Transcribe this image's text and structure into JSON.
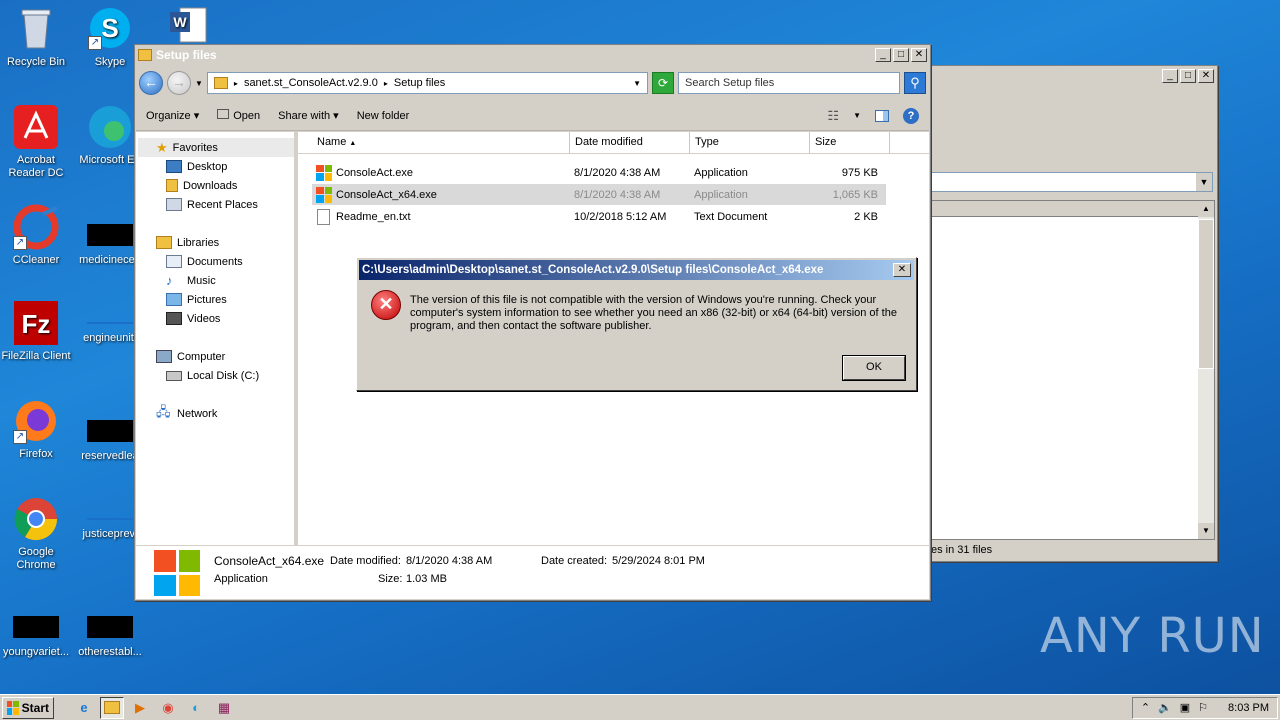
{
  "desktop": {
    "icons": [
      {
        "label": "Recycle Bin"
      },
      {
        "label": "Skype"
      },
      {
        "label": "Acrobat Reader DC"
      },
      {
        "label": "Microsoft Ed"
      },
      {
        "label": "CCleaner"
      },
      {
        "label": "medicinecen"
      },
      {
        "label": "FileZilla Client"
      },
      {
        "label": "engineunit."
      },
      {
        "label": "Firefox"
      },
      {
        "label": "reservedlea"
      },
      {
        "label": "Google Chrome"
      },
      {
        "label": "justiceprevi"
      },
      {
        "label": "youngvariet..."
      },
      {
        "label": "otherestabl..."
      }
    ]
  },
  "back_window": {
    "status_fragment": "es in 31 files"
  },
  "explorer": {
    "title": "Setup files",
    "breadcrumb": [
      "sanet.st_ConsoleAct.v2.9.0",
      "Setup files"
    ],
    "search_placeholder": "Search Setup files",
    "toolbar": {
      "organize": "Organize",
      "open": "Open",
      "share_with": "Share with",
      "new_folder": "New folder"
    },
    "nav": {
      "favorites": "Favorites",
      "favorites_items": [
        "Desktop",
        "Downloads",
        "Recent Places"
      ],
      "libraries": "Libraries",
      "libraries_items": [
        "Documents",
        "Music",
        "Pictures",
        "Videos"
      ],
      "computer": "Computer",
      "computer_items": [
        "Local Disk (C:)"
      ],
      "network": "Network"
    },
    "columns": {
      "name": "Name",
      "date": "Date modified",
      "type": "Type",
      "size": "Size"
    },
    "files": [
      {
        "name": "ConsoleAct.exe",
        "date": "8/1/2020 4:38 AM",
        "type": "Application",
        "size": "975 KB",
        "icon": "ms-logo-icon"
      },
      {
        "name": "ConsoleAct_x64.exe",
        "date": "8/1/2020 4:38 AM",
        "type": "Application",
        "size": "1,065 KB",
        "icon": "ms-logo-icon",
        "selected": true
      },
      {
        "name": "Readme_en.txt",
        "date": "10/2/2018 5:12 AM",
        "type": "Text Document",
        "size": "2 KB",
        "icon": "text-file-icon"
      }
    ],
    "details": {
      "name": "ConsoleAct_x64.exe",
      "modified_label": "Date modified:",
      "modified": "8/1/2020 4:38 AM",
      "created_label": "Date created:",
      "created": "5/29/2024 8:01 PM",
      "type": "Application",
      "size_label": "Size:",
      "size": "1.03 MB"
    }
  },
  "dialog": {
    "title": "C:\\Users\\admin\\Desktop\\sanet.st_ConsoleAct.v2.9.0\\Setup files\\ConsoleAct_x64.exe",
    "message": "The version of this file is not compatible with the version of Windows you're running. Check your computer's system information to see whether you need an x86 (32-bit) or x64 (64-bit) version of the program, and then contact the software publisher.",
    "ok": "OK"
  },
  "taskbar": {
    "start": "Start",
    "clock": "8:03 PM"
  },
  "watermark": "ANY RUN"
}
